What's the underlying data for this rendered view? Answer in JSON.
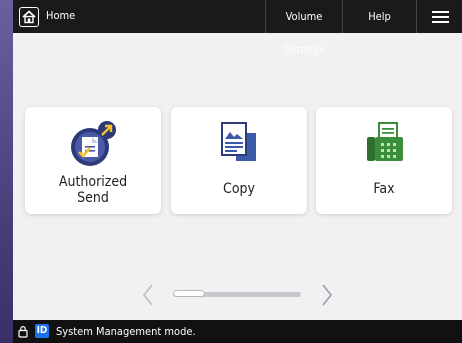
{
  "topbar": {
    "home_label": "Home",
    "volume_settings": "Volume Settings",
    "help": "Help"
  },
  "tiles": [
    {
      "label": "Authorized\nSend",
      "icon": "authorized-send-icon"
    },
    {
      "label": "Copy",
      "icon": "copy-icon"
    },
    {
      "label": "Fax",
      "icon": "fax-icon"
    }
  ],
  "pager": {
    "current_page": 1,
    "total_pages": 4
  },
  "status": {
    "text": "System Management mode.",
    "badge": "ID"
  },
  "colors": {
    "accent": "#1a73e8",
    "topbar": "#1a1a1a",
    "fax_green": "#3a8e3a",
    "copy_blue": "#3b5aa8"
  }
}
